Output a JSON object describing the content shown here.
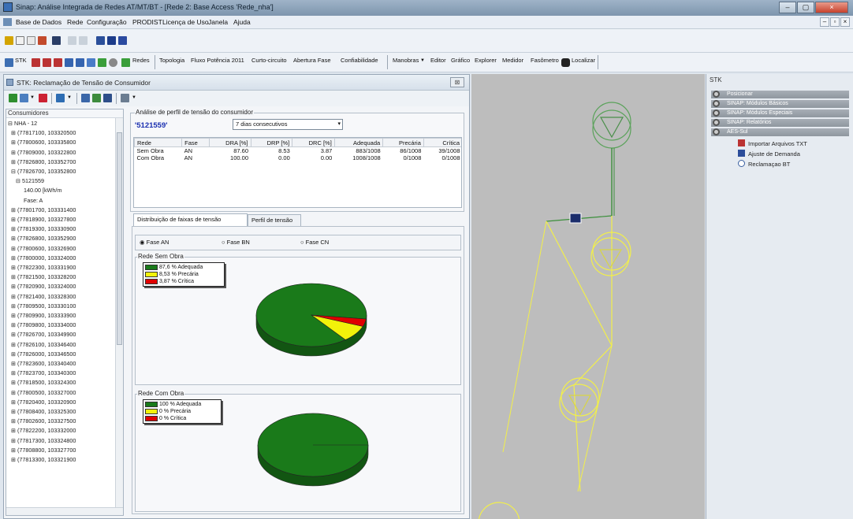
{
  "window": {
    "title": "Sinap: Análise Integrada de Redes AT/MT/BT - [Rede 2: Base Access 'Rede_nha']",
    "controls": [
      "–",
      "▢",
      "×"
    ]
  },
  "menu": [
    "Base de Dados",
    "Rede",
    "Configuração",
    "PRODIST",
    "Licença de Uso",
    "Janela",
    "Ajuda"
  ],
  "toolbar2": {
    "stk_label": "STK",
    "redes_label": "Redes",
    "tabs": [
      "Topologia",
      "Fluxo Potência 2011",
      "Curto-circuito",
      "Abertura Fase",
      "Confiabilidade",
      "Manobras",
      "Editor",
      "Gráfico",
      "Explorer",
      "Medidor",
      "Fasômetro",
      "Localizar"
    ]
  },
  "stk_panel": {
    "title": "STK: Reclamação de Tensão de Consumidor",
    "close": "⊠"
  },
  "tree": {
    "header": "Consumidores",
    "rows": [
      "⊟ NHA - 12",
      "  ⊞ (77817100, 103320500",
      "  ⊞ (77800600, 103335800",
      "  ⊞ (77809000, 103322800",
      "  ⊞ (77826800, 103352700",
      "  ⊟ (77826700, 103352800",
      "     ⊟ 5121559",
      "          140.00 [kWh/m",
      "          Fase: A",
      "  ⊞ (77801700, 103331400",
      "  ⊞ (77818900, 103327800",
      "  ⊞ (77819300, 103330900",
      "  ⊞ (77826800, 103352900",
      "  ⊞ (77800600, 103326900",
      "  ⊞ (77800000, 103324000",
      "  ⊞ (77822300, 103331900",
      "  ⊞ (77821500, 103328200",
      "  ⊞ (77820900, 103324000",
      "  ⊞ (77821400, 103328300",
      "  ⊞ (77809500, 103330100",
      "  ⊞ (77809900, 103333900",
      "  ⊞ (77809800, 103334000",
      "  ⊞ (77826700, 103349900",
      "  ⊞ (77826100, 103346400",
      "  ⊞ (77826000, 103346500",
      "  ⊞ (77823600, 103340400",
      "  ⊞ (77823700, 103340300",
      "  ⊞ (77818500, 103324300",
      "  ⊞ (77800500, 103327000",
      "  ⊞ (77820400, 103320900",
      "  ⊞ (77808400, 103325300",
      "  ⊞ (77802600, 103327500",
      "  ⊞ (77822200, 103332000",
      "  ⊞ (77817300, 103324800",
      "  ⊞ (77808800, 103327700",
      "  ⊞ (77813300, 103321900"
    ]
  },
  "analysis": {
    "group_label": "Análise de perfil de tensão do consumidor",
    "consumer_id": "5121559",
    "period": "7 dias consecutivos",
    "table": {
      "columns": [
        "Rede",
        "Fase",
        "DRA [%]",
        "DRP [%]",
        "DRC [%]",
        "Adequada",
        "Precária",
        "Crítica"
      ],
      "rows": [
        [
          "Sem Obra",
          "AN",
          "87.60",
          "8.53",
          "3.87",
          "883/1008",
          "86/1008",
          "39/1008"
        ],
        [
          "Com Obra",
          "AN",
          "100.00",
          "0.00",
          "0.00",
          "1008/1008",
          "0/1008",
          "0/1008"
        ]
      ]
    },
    "tabs": [
      "Distribuição de faixas de tensão",
      "Perfil de tensão"
    ],
    "phases": [
      "Fase AN",
      "Fase BN",
      "Fase CN"
    ],
    "selected_phase": "Fase AN",
    "charts": [
      {
        "label": "Rede Sem Obra",
        "legend": [
          "87,6 % Adequada",
          "8,53 % Precária",
          "3,87 % Crítica"
        ]
      },
      {
        "label": "Rede Com Obra",
        "legend": [
          "100 % Adequada",
          "0 % Precária",
          "0 % Crítica"
        ]
      }
    ],
    "colors": {
      "adequada": "#1a7a1a",
      "precaria": "#f2f20a",
      "critica": "#e00000"
    }
  },
  "right_panel": {
    "title": "STK",
    "bars": [
      "Posicionar",
      "SINAP: Módulos Básicos",
      "SINAP: Módulos Especiais",
      "SINAP: Relatórios",
      "AES-Sul"
    ],
    "items": [
      "Importar Arquivos TXT",
      "Ajuste de Demanda",
      "Reclamaçao BT"
    ]
  },
  "chart_data": [
    {
      "type": "pie",
      "title": "Rede Sem Obra",
      "categories": [
        "Adequada",
        "Precária",
        "Crítica"
      ],
      "values": [
        87.6,
        8.53,
        3.87
      ],
      "colors": [
        "#1a7a1a",
        "#f2f20a",
        "#e00000"
      ],
      "legend": "top-left"
    },
    {
      "type": "pie",
      "title": "Rede Com Obra",
      "categories": [
        "Adequada",
        "Precária",
        "Crítica"
      ],
      "values": [
        100,
        0,
        0
      ],
      "colors": [
        "#1a7a1a",
        "#f2f20a",
        "#e00000"
      ],
      "legend": "top-left"
    }
  ]
}
